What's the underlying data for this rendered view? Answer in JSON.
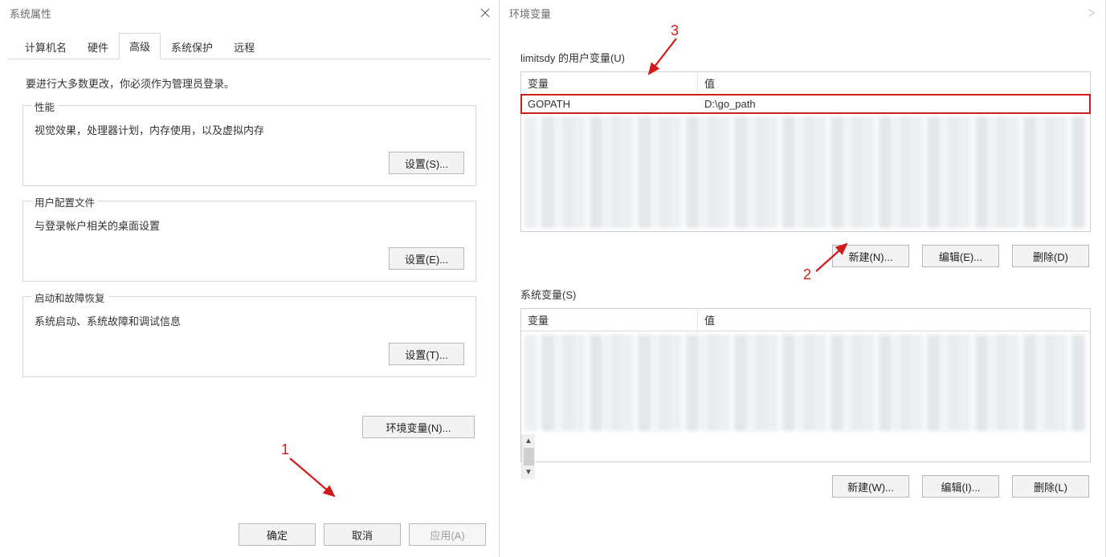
{
  "left": {
    "title": "系统属性",
    "tabs": [
      "计算机名",
      "硬件",
      "高级",
      "系统保护",
      "远程"
    ],
    "active_tab_index": 2,
    "admin_note": "要进行大多数更改，你必须作为管理员登录。",
    "groups": {
      "performance": {
        "title": "性能",
        "desc": "视觉效果，处理器计划，内存使用，以及虚拟内存",
        "button": "设置(S)..."
      },
      "profiles": {
        "title": "用户配置文件",
        "desc": "与登录帐户相关的桌面设置",
        "button": "设置(E)..."
      },
      "startup": {
        "title": "启动和故障恢复",
        "desc": "系统启动、系统故障和调试信息",
        "button": "设置(T)..."
      }
    },
    "env_button": "环境变量(N)...",
    "footer": {
      "ok": "确定",
      "cancel": "取消",
      "apply": "应用(A)"
    }
  },
  "right": {
    "title": "环境变量",
    "user_section_label": "limitsdy 的用户变量(U)",
    "system_section_label": "系统变量(S)",
    "columns": {
      "var": "变量",
      "val": "值"
    },
    "user_rows": [
      {
        "name": "GOPATH",
        "value": "D:\\go_path",
        "highlight": true
      }
    ],
    "user_buttons": {
      "new": "新建(N)...",
      "edit": "编辑(E)...",
      "delete": "删除(D)"
    },
    "system_buttons": {
      "new": "新建(W)...",
      "edit": "编辑(I)...",
      "delete": "删除(L)"
    }
  },
  "annotations": {
    "one": "1",
    "two": "2",
    "three": "3"
  }
}
